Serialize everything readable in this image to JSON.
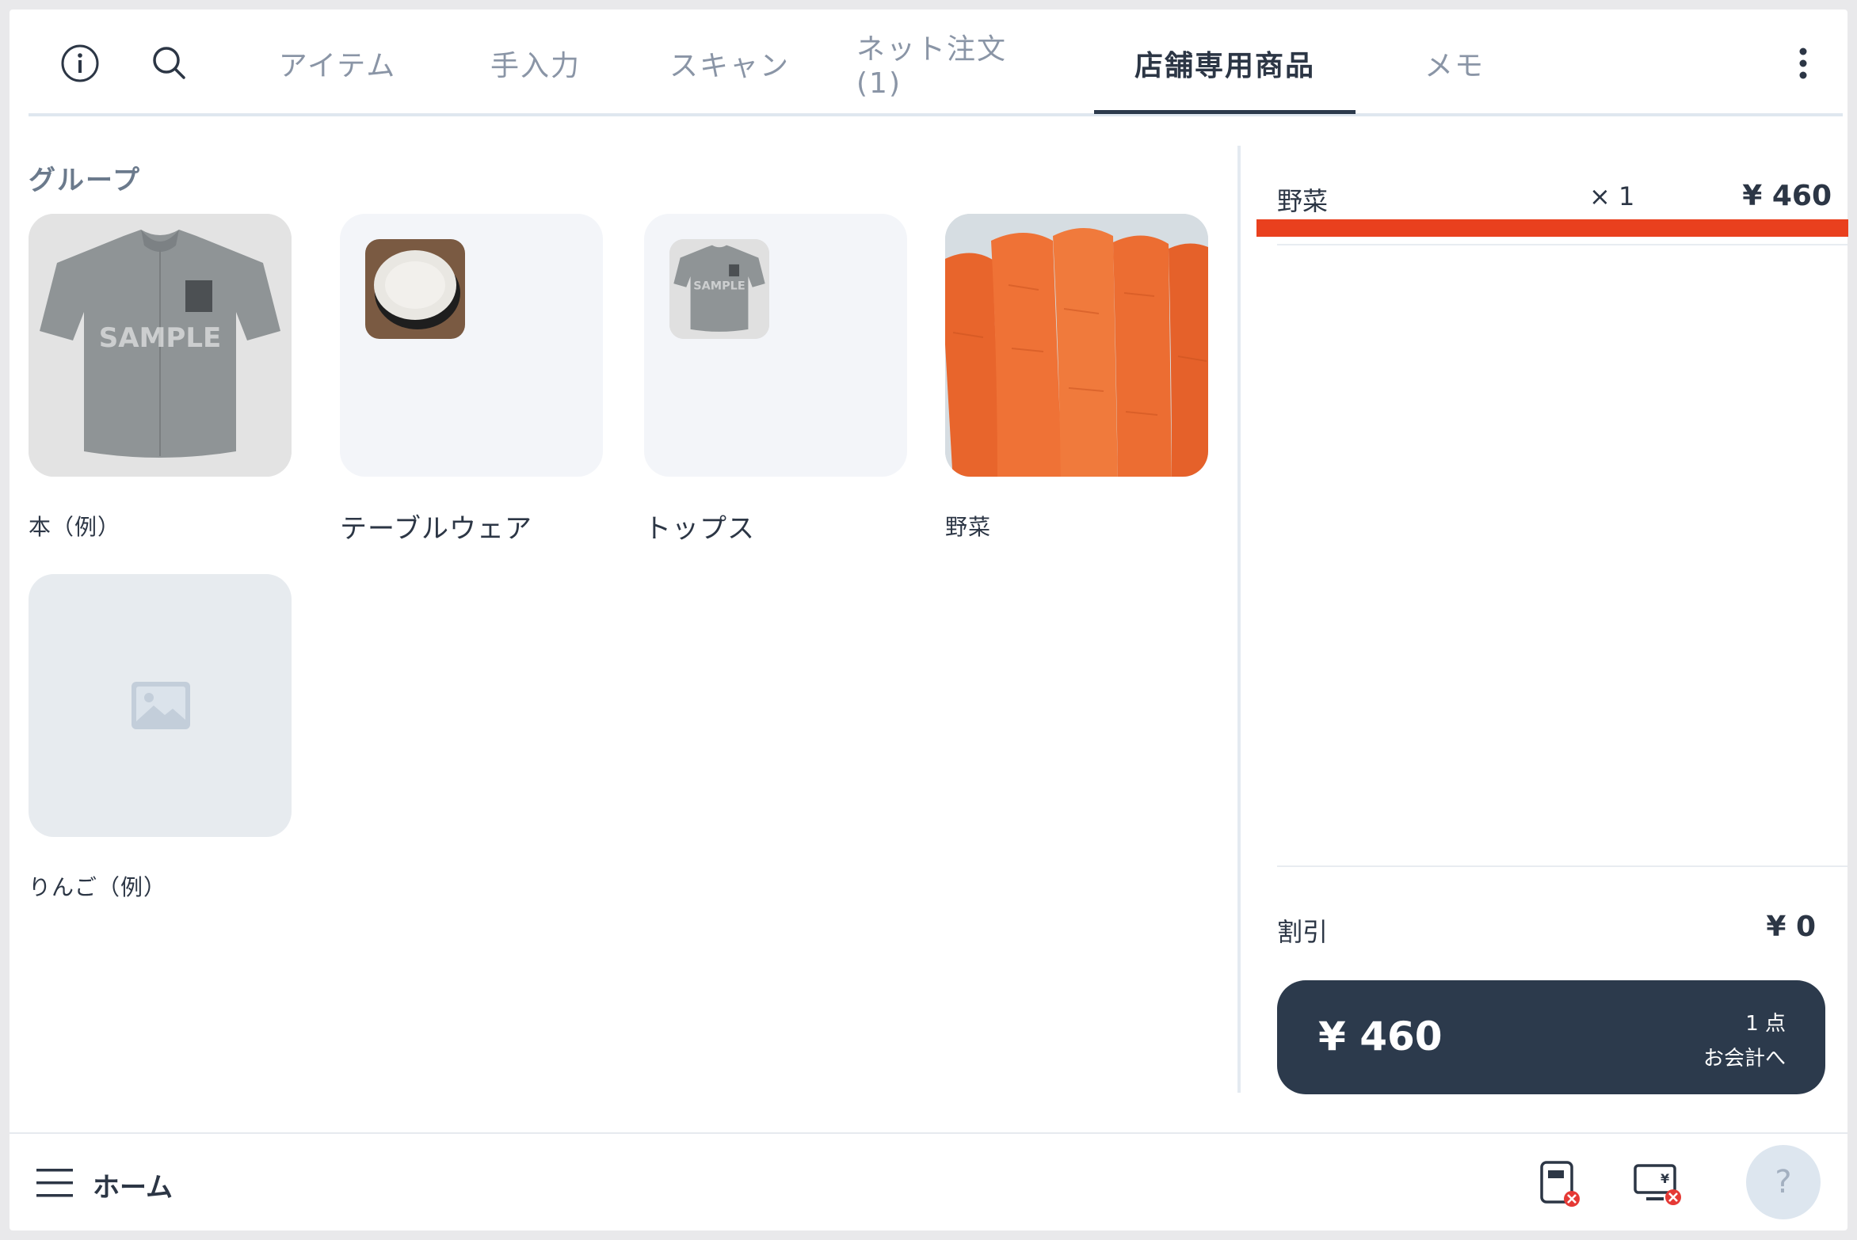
{
  "header": {
    "tabs": [
      {
        "label": "アイテム",
        "active": false
      },
      {
        "label": "手入力",
        "active": false
      },
      {
        "label": "スキャン",
        "active": false
      },
      {
        "label": "ネット注文 (1)",
        "active": false
      },
      {
        "label": "店舗専用商品",
        "active": true
      },
      {
        "label": "メモ",
        "active": false
      }
    ],
    "icons": [
      "info-icon",
      "search-icon",
      "more-vertical-icon"
    ]
  },
  "main": {
    "section_title": "グループ",
    "groups": [
      {
        "label": "本（例）",
        "image": "shirt-photo"
      },
      {
        "label": "テーブルウェア",
        "image": "plate-thumbnail"
      },
      {
        "label": "トップス",
        "image": "shirt-thumbnail"
      },
      {
        "label": "野菜",
        "image": "carrots-photo"
      },
      {
        "label": "りんご（例）",
        "image": "image-placeholder-icon"
      }
    ],
    "watermark_text": "SAMPLE"
  },
  "cart": {
    "items": [
      {
        "name": "野菜",
        "qty": "× 1",
        "price": "¥ 460"
      }
    ],
    "discount_label": "割引",
    "discount_value": "¥ 0",
    "checkout_total": "¥ 460",
    "checkout_count": "1 点",
    "checkout_action": "お会計へ"
  },
  "footer": {
    "home_label": "ホーム",
    "help_label": "?",
    "icons": [
      "menu-icon",
      "card-reader-disconnected-icon",
      "register-display-disconnected-icon"
    ]
  },
  "colors": {
    "accent": "#2c3a4c",
    "alert_bar": "#e9401e",
    "error_badge": "#e53935",
    "tab_inactive": "#8a95a6"
  }
}
